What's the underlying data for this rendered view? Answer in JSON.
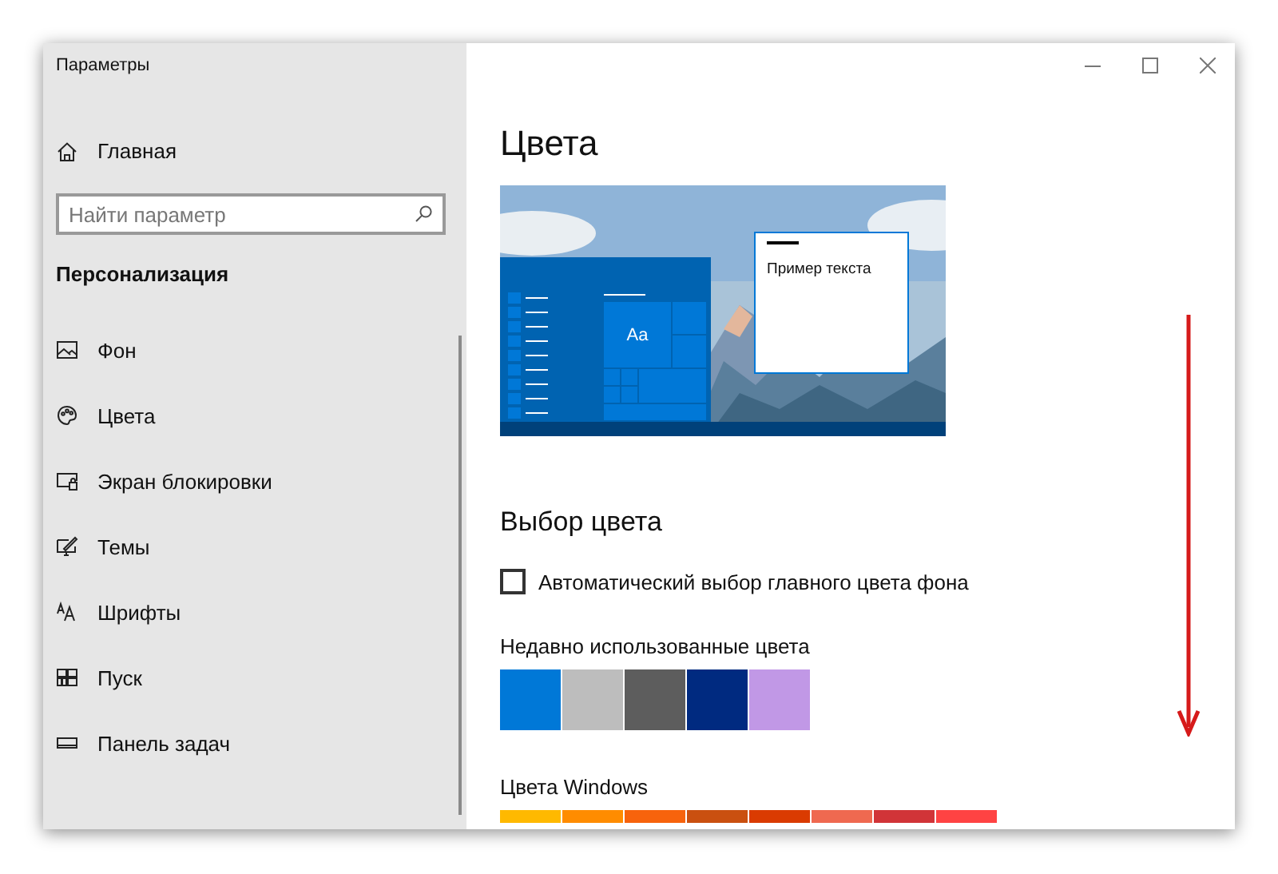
{
  "window": {
    "title": "Параметры"
  },
  "sidebar": {
    "home": "Главная",
    "search": {
      "placeholder": "Найти параметр"
    },
    "section": "Персонализация",
    "items": [
      {
        "label": "Фон",
        "kind": "background"
      },
      {
        "label": "Цвета",
        "kind": "colors"
      },
      {
        "label": "Экран блокировки",
        "kind": "lock"
      },
      {
        "label": "Темы",
        "kind": "themes"
      },
      {
        "label": "Шрифты",
        "kind": "fonts"
      },
      {
        "label": "Пуск",
        "kind": "start"
      },
      {
        "label": "Панель задач",
        "kind": "taskbar"
      }
    ]
  },
  "content": {
    "title": "Цвета",
    "preview": {
      "tile_label": "Aa",
      "sample_text": "Пример текста"
    },
    "color_choice": {
      "heading": "Выбор цвета",
      "auto_checkbox": {
        "label": "Автоматический выбор главного цвета фона",
        "checked": false
      },
      "recent_label": "Недавно использованные цвета",
      "recent_colors": [
        {
          "color": "#0078d7"
        },
        {
          "color": "#bdbdbd"
        },
        {
          "color": "#5d5d5d"
        },
        {
          "color": "#002a80"
        },
        {
          "color": "#c198e6"
        }
      ],
      "windows_label": "Цвета Windows",
      "windows_colors": [
        {
          "color": "#ffb900"
        },
        {
          "color": "#ff8c00"
        },
        {
          "color": "#f7630c"
        },
        {
          "color": "#ca5010"
        },
        {
          "color": "#da3b01"
        },
        {
          "color": "#ef6950"
        },
        {
          "color": "#d13438"
        },
        {
          "color": "#ff4343"
        }
      ]
    }
  }
}
